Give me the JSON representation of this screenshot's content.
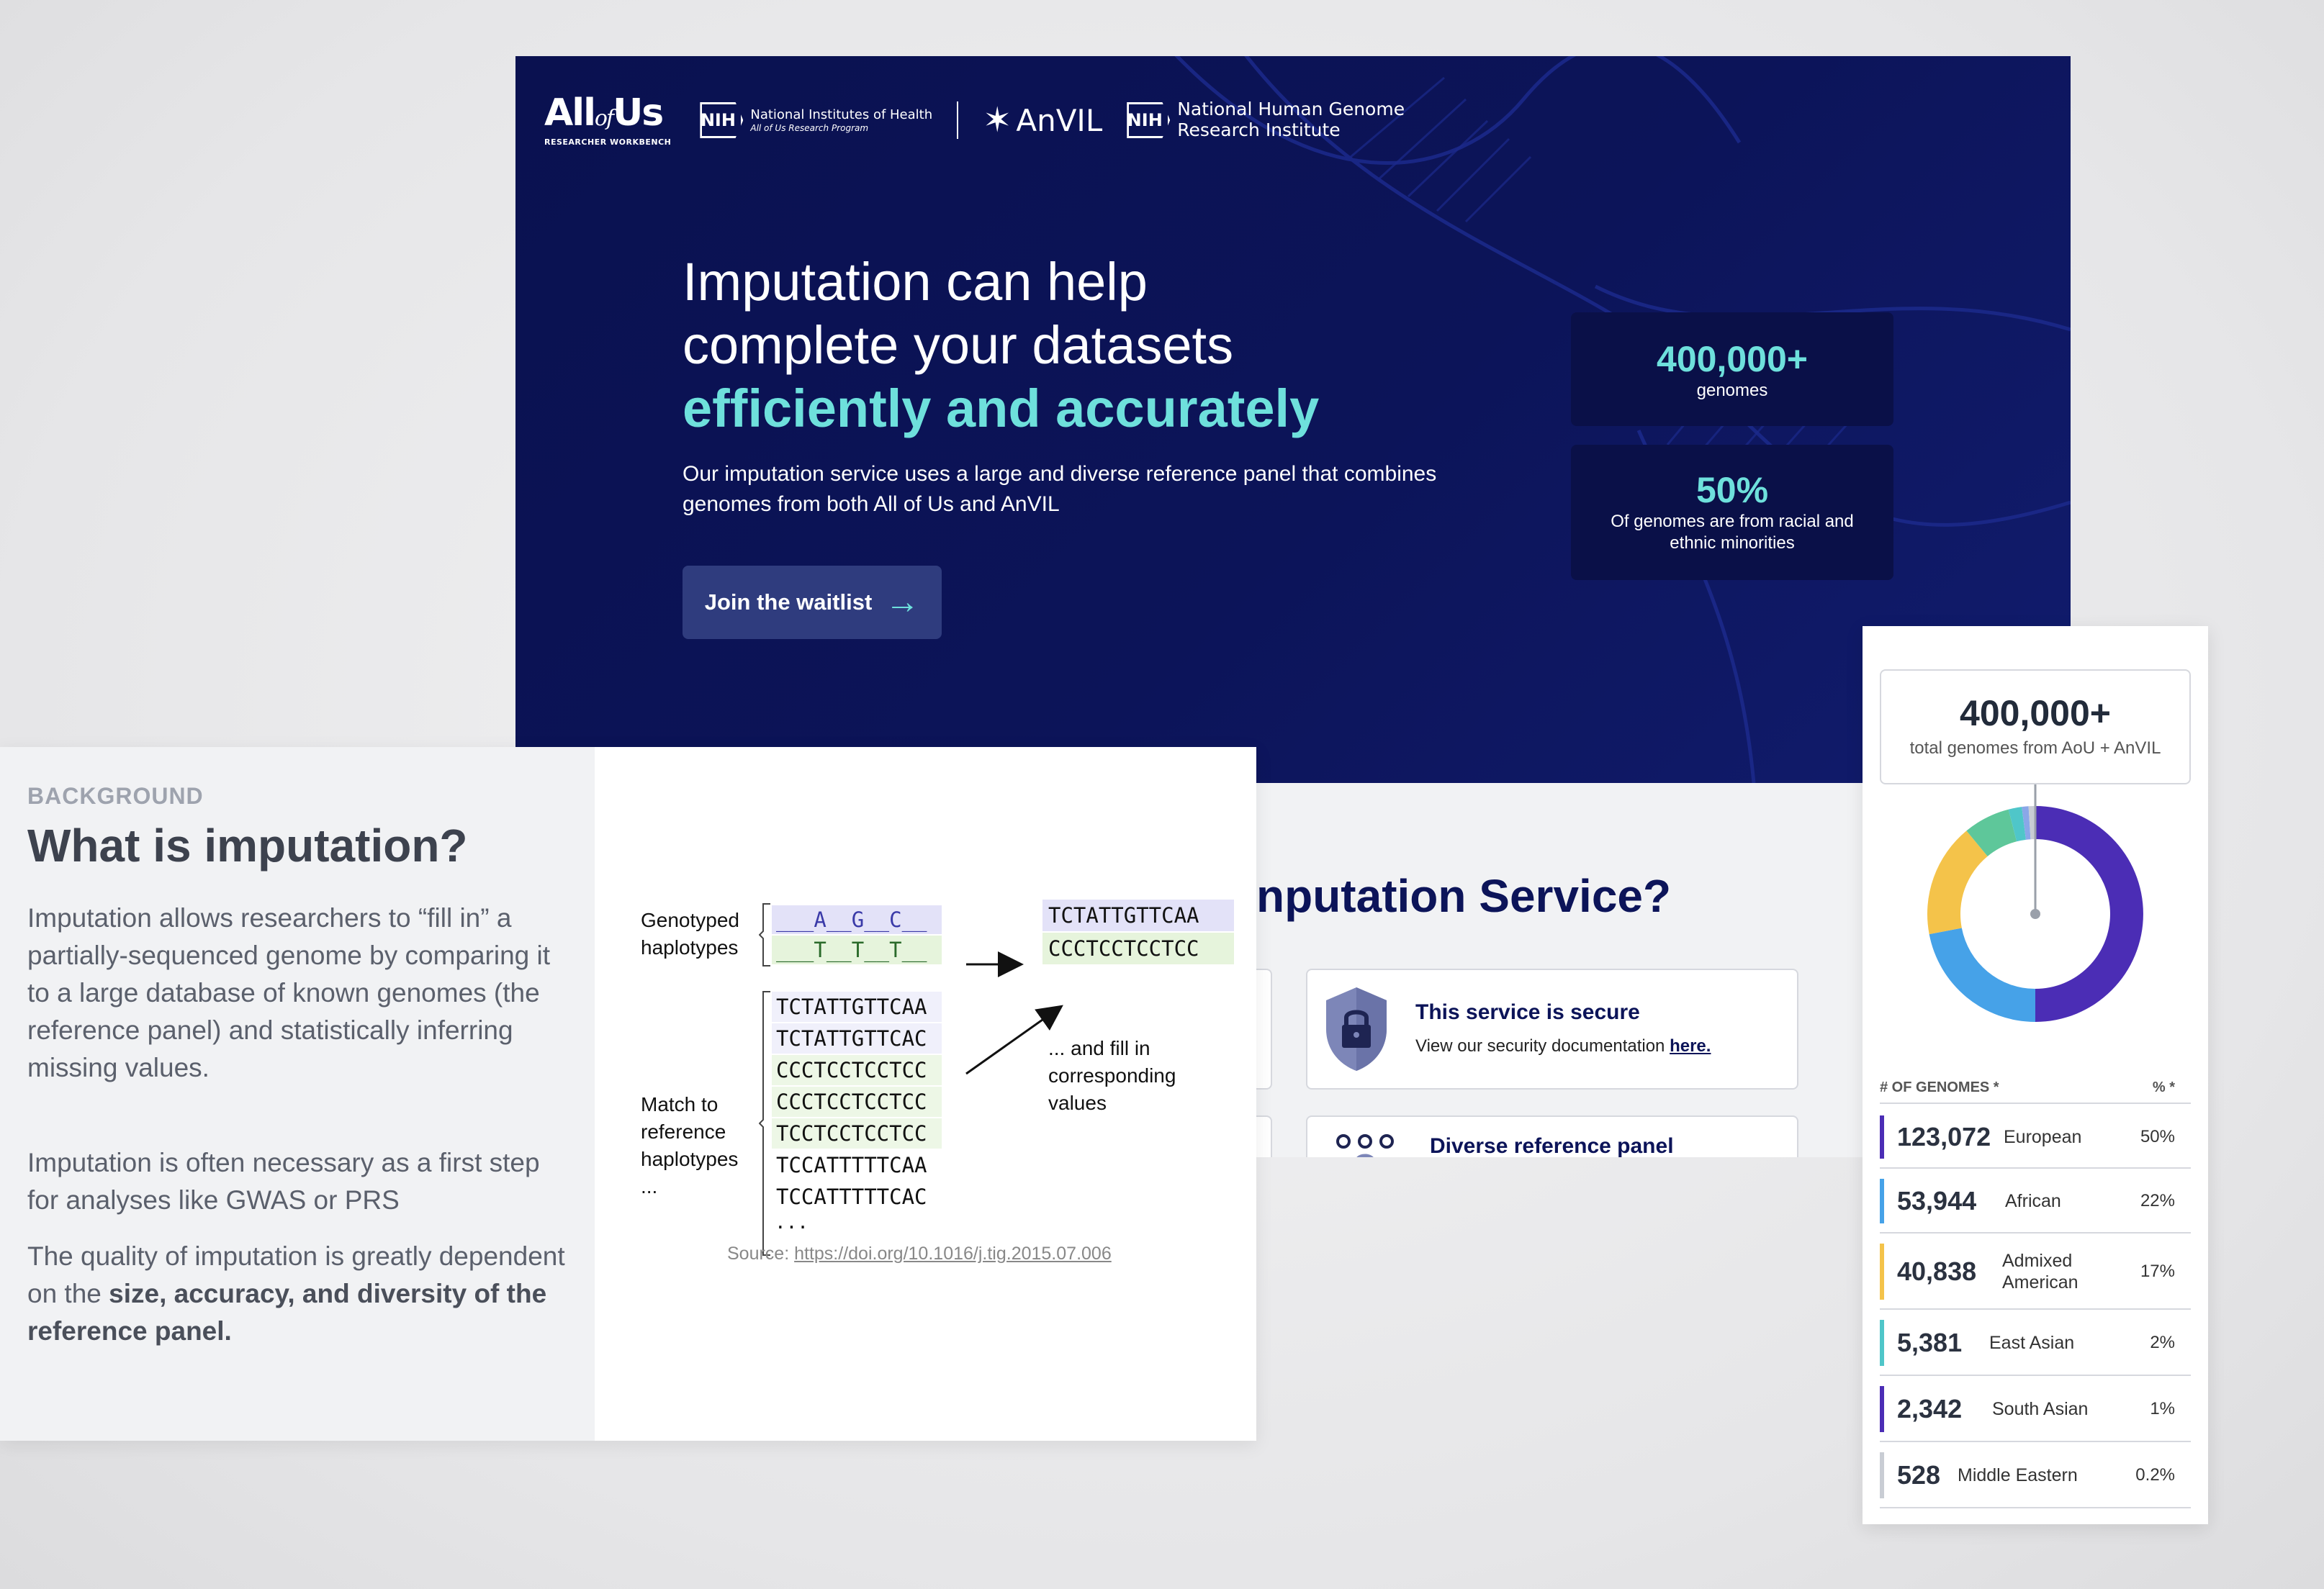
{
  "hero": {
    "logos": {
      "aou_main": "All",
      "aou_of": "of",
      "aou_us": "Us",
      "aou_sub": "RESEARCHER WORKBENCH",
      "nih_badge": "NIH",
      "nih_name": "National Institutes of Health",
      "nih_program": "All of Us Research Program",
      "anvil": "AnVIL",
      "nhgri_badge": "NIH",
      "nhgri_line1": "National Human Genome",
      "nhgri_line2": "Research Institute"
    },
    "title_line1": "Imputation can help",
    "title_line2": "complete your datasets",
    "title_accent": "efficiently and accurately",
    "description": "Our imputation service uses a large and diverse reference panel that combines genomes from both All of Us and AnVIL",
    "cta_label": "Join the waitlist",
    "stats": [
      {
        "value": "400,000+",
        "label": "genomes"
      },
      {
        "value": "50%",
        "label": "Of genomes are from racial and ethnic minorities"
      }
    ],
    "colors": {
      "background": "#0c1459",
      "accent": "#6ee0dc",
      "button": "#2f3c7e"
    }
  },
  "middle": {
    "section_title": "nputation Service?",
    "features": [
      {
        "icon": "lock-shield-icon",
        "title": "This service is secure",
        "description": "View our security documentation ",
        "link": "here."
      },
      {
        "icon": "people-icon",
        "title": "Diverse reference panel"
      }
    ]
  },
  "background_card": {
    "kicker": "BACKGROUND",
    "title": "What is imputation?",
    "paragraph1": "Imputation allows researchers to “fill in” a partially-sequenced genome by comparing it to a large database of known genomes (the reference panel) and statistically inferring missing values.",
    "paragraph2": "Imputation is often necessary as a first step for analyses like GWAS or PRS",
    "paragraph3_prefix": "The quality of imputation is greatly dependent on the ",
    "paragraph3_bold": "size, accuracy, and diversity of the reference panel.",
    "diagram": {
      "genotyped_label_1": "Genotyped",
      "genotyped_label_2": "haplotypes",
      "genotyped_rows": [
        "___A__G__C__",
        "___T__T__T__"
      ],
      "match_label_1": "Match to",
      "match_label_2": "reference",
      "match_label_3": "haplotypes",
      "ellipsis": "...",
      "reference_rows": [
        "TCTATTGTTCAA",
        "TCTATTGTTCAC",
        "CCCTCCTCCTCC",
        "CCCTCCTCCTCC",
        "TCCTCCTCCTCC",
        "TCCATTTTTCAA",
        "TCCATTTTTCAC"
      ],
      "imputed_rows": [
        "TCTATTGTTCAA",
        "CCCTCCTCCTCC"
      ],
      "fill_label_1": "... and fill in",
      "fill_label_2": "corresponding",
      "fill_label_3": "values",
      "source_prefix": "Source: ",
      "source_link": "https://doi.org/10.1016/j.tig.2015.07.006"
    }
  },
  "stats_card": {
    "total_value": "400,000+",
    "total_label": "total genomes from AoU + AnVIL",
    "col_genomes": "# OF GENOMES *",
    "col_pct": "% *",
    "rows": [
      {
        "count": "123,072",
        "name": "European",
        "pct": "50%",
        "color": "#4b2db5"
      },
      {
        "count": "53,944",
        "name": "African",
        "pct": "22%",
        "color": "#46a2e8"
      },
      {
        "count": "40,838",
        "name": "Admixed American",
        "pct": "17%",
        "color": "#f4c34a"
      },
      {
        "count": "5,381",
        "name": "East Asian",
        "pct": "2%",
        "color": "#4fc6c9"
      },
      {
        "count": "2,342",
        "name": "South Asian",
        "pct": "1%",
        "color": "#4b2db5"
      },
      {
        "count": "528",
        "name": "Middle Eastern",
        "pct": "0.2%",
        "color": "#c9cdd4"
      }
    ],
    "donut": [
      {
        "name": "European",
        "value": 50,
        "color": "#4b2db5"
      },
      {
        "name": "African",
        "value": 22,
        "color": "#46a2e8"
      },
      {
        "name": "Admixed American",
        "value": 17,
        "color": "#f4c34a"
      },
      {
        "name": "other",
        "value": 7,
        "color": "#5ec79a"
      },
      {
        "name": "East Asian",
        "value": 2,
        "color": "#4fc6c9"
      },
      {
        "name": "South Asian",
        "value": 1,
        "color": "#8aa7e8"
      },
      {
        "name": "Middle Eastern",
        "value": 1,
        "color": "#c9cdd4"
      }
    ]
  }
}
